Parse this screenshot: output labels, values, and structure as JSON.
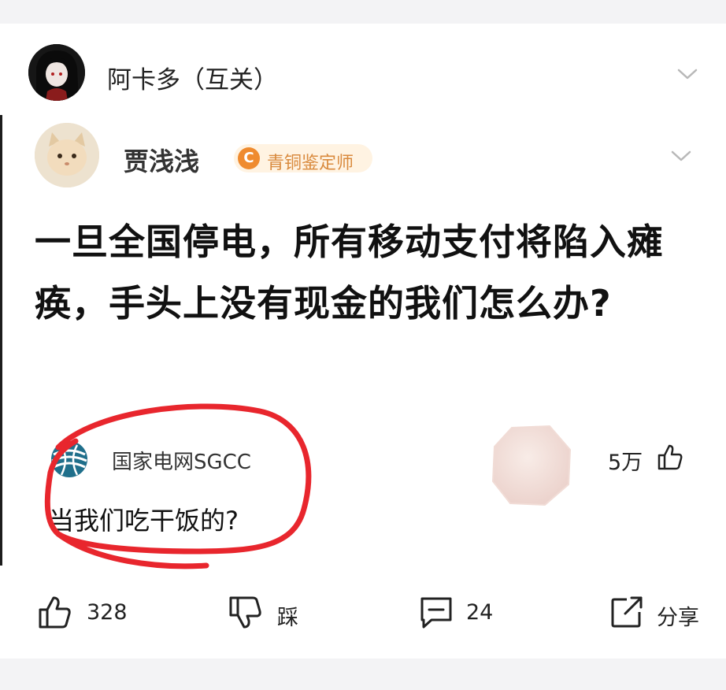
{
  "outer_post": {
    "author": "阿卡多（互关）",
    "avatar_icon": "anime-avatar"
  },
  "quoted_post": {
    "author": "贾浅浅",
    "badge_icon": "C",
    "badge": "青铜鉴定师",
    "question": "一旦全国停电，所有移动支付将陷入瘫痪，手头上没有现金的我们怎么办?",
    "answer": {
      "author": "国家电网SGCC",
      "text": "当我们吃干饭的?",
      "likes": "5万"
    }
  },
  "actions": {
    "like_count": "328",
    "dislike_label": "踩",
    "comment_count": "24",
    "share_label": "分享"
  },
  "colors": {
    "annotation_red": "#e8262d",
    "badge_orange": "#ef8b2f",
    "background_band": "#f3f3f5"
  }
}
